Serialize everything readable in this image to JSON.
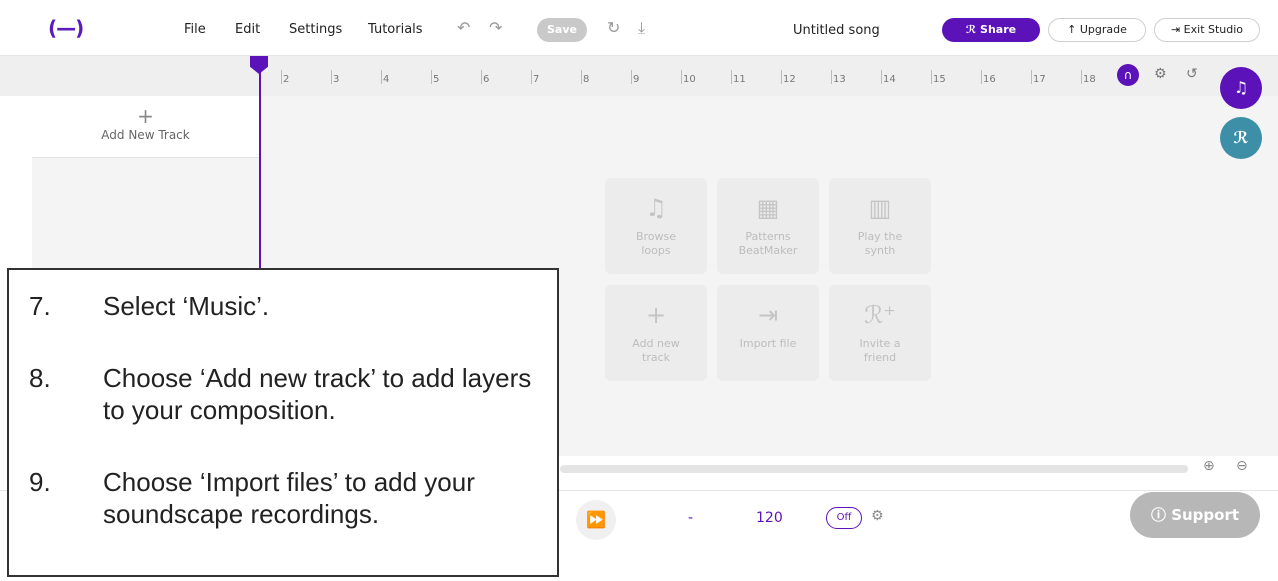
{
  "topbar": {
    "menu": [
      "File",
      "Edit",
      "Settings",
      "Tutorials"
    ],
    "save_label": "Save",
    "song_title": "Untitled song",
    "share_label": "Share",
    "upgrade_label": "Upgrade",
    "exit_label": "Exit Studio"
  },
  "ruler": {
    "ticks": [
      "2",
      "3",
      "4",
      "5",
      "6",
      "7",
      "8",
      "9",
      "10",
      "11",
      "12",
      "13",
      "14",
      "15",
      "16",
      "17",
      "18"
    ]
  },
  "track_panel": {
    "add_label": "Add New Track"
  },
  "tiles": [
    {
      "icon": "music-note-icon",
      "label": "Browse\nloops"
    },
    {
      "icon": "grid-icon",
      "label": "Patterns\nBeatMaker"
    },
    {
      "icon": "piano-icon",
      "label": "Play the\nsynth"
    },
    {
      "icon": "plus-icon",
      "label": "Add new\ntrack"
    },
    {
      "icon": "import-icon",
      "label": "Import file"
    },
    {
      "icon": "invite-icon",
      "label": "Invite a\nfriend"
    }
  ],
  "transport": {
    "time": "-",
    "bpm": "120",
    "metronome": "Off"
  },
  "support_label": "Support",
  "instructions": [
    {
      "num": "7.",
      "text": "Select ‘Music’."
    },
    {
      "num": "8.",
      "text": "Choose ‘Add new track’ to add layers to your composition."
    },
    {
      "num": "9.",
      "text": "Choose ‘Import files’ to add your soundscape recordings."
    }
  ]
}
